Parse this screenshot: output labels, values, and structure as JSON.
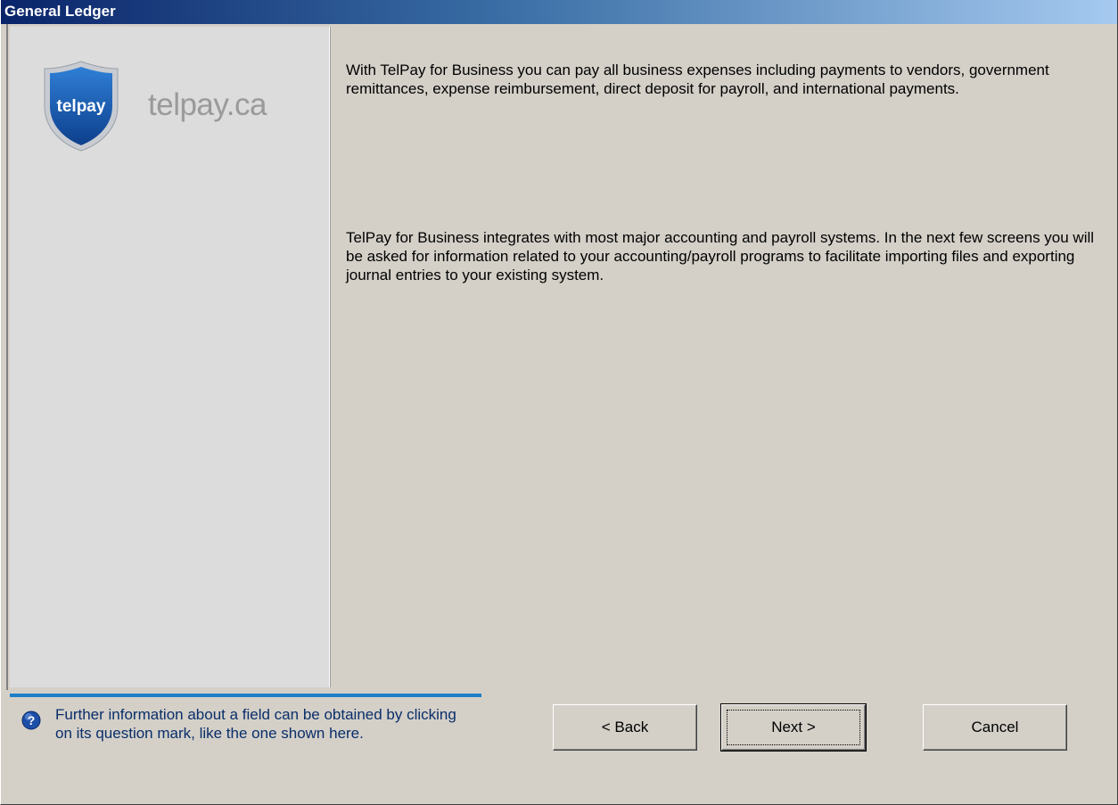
{
  "window": {
    "title": "General Ledger"
  },
  "sidebar": {
    "logo_icon": "telpay-shield-logo",
    "logo_text": "telpay",
    "site": "telpay.ca"
  },
  "main": {
    "paragraph1": "With TelPay for Business you can pay all business expenses including payments to vendors, government remittances, expense reimbursement, direct deposit for payroll, and international payments.",
    "paragraph2": "TelPay for Business integrates with most major accounting and payroll systems.  In the next few screens you will be asked for information related to your accounting/payroll programs to facilitate importing files and exporting journal entries to your existing system."
  },
  "help": {
    "icon": "question-mark-icon",
    "text": "Further information about a field can be obtained by clicking on its question mark, like the one shown here."
  },
  "buttons": {
    "back": "< Back",
    "next": "Next >",
    "cancel": "Cancel"
  },
  "colors": {
    "titlebar_start": "#0a246a",
    "titlebar_end": "#a6caf0",
    "dialog_bg": "#d4d0c8",
    "accent_line": "#1c7fc7",
    "logo_blue": "#1a5fb4"
  }
}
